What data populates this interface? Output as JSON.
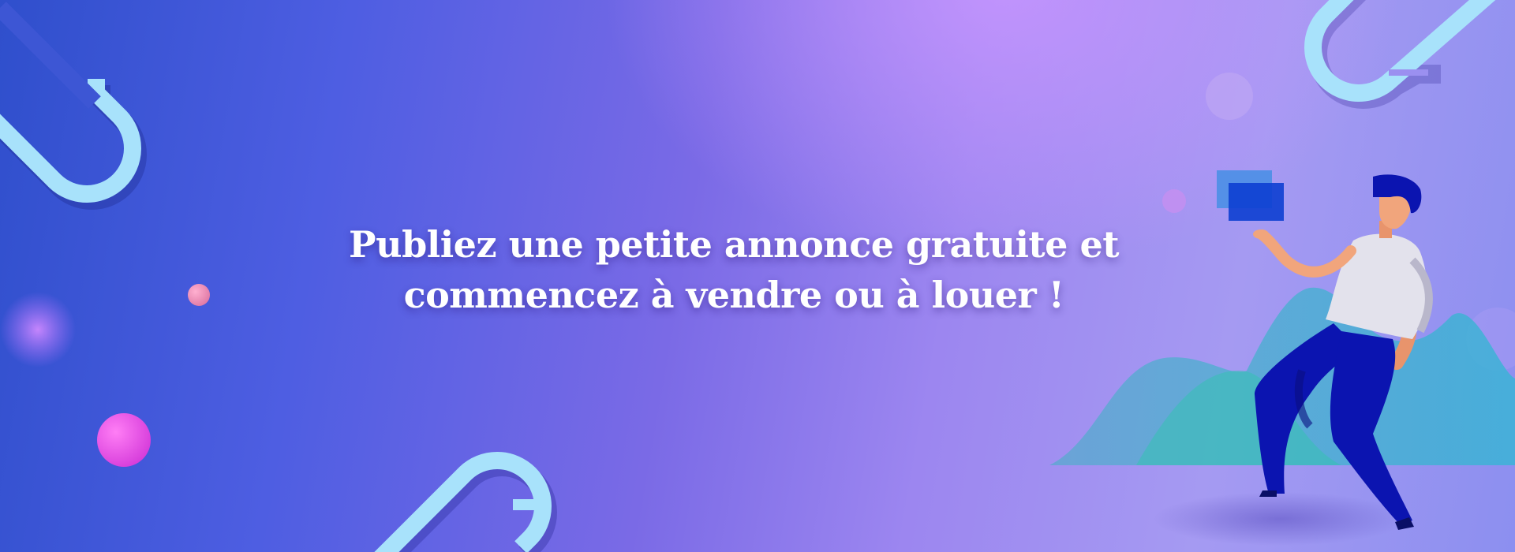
{
  "banner": {
    "headline": "Publiez une petite annonce gratuite et commencez à vendre ou à louer !"
  },
  "icons": [
    "paperclip-icon",
    "person-illustration",
    "hill-illustration",
    "bubble-icon"
  ],
  "colors": {
    "background_start": "#2f4fcc",
    "background_end": "#a59af2",
    "text": "#ffffff",
    "clip": "#a8e2fb",
    "figure_pants": "#0b14b0",
    "hills": "#44b8c8"
  }
}
